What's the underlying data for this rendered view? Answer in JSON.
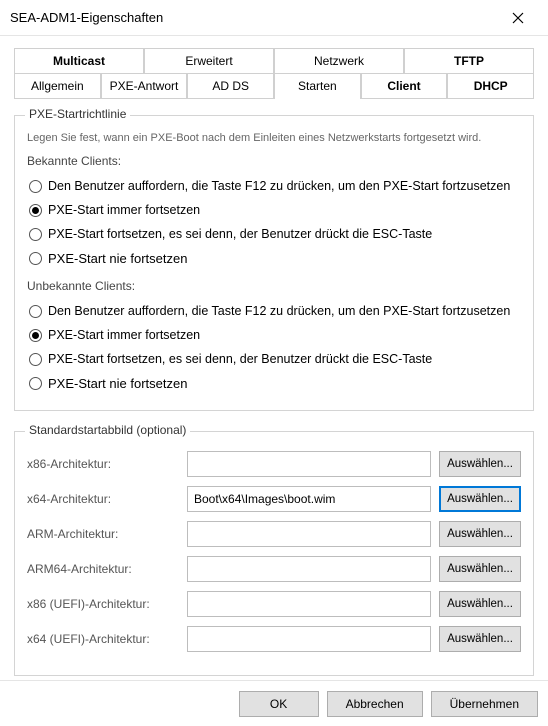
{
  "window": {
    "title": "SEA-ADM1-Eigenschaften"
  },
  "tabs_row1": [
    {
      "label": "Multicast",
      "bold": true
    },
    {
      "label": "Erweitert"
    },
    {
      "label": "Netzwerk"
    },
    {
      "label": "TFTP",
      "bold": true
    }
  ],
  "tabs_row2": [
    {
      "label": "Allgemein"
    },
    {
      "label": "PXE-Antwort"
    },
    {
      "label": "AD DS"
    },
    {
      "label": "Starten",
      "active": true
    },
    {
      "label": "Client",
      "bold": true
    },
    {
      "label": "DHCP",
      "bold": true
    }
  ],
  "policy": {
    "title": "PXE-Startrichtlinie",
    "desc": "Legen Sie fest, wann ein PXE-Boot nach dem Einleiten eines Netzwerkstarts fortgesetzt wird.",
    "known_header": "Bekannte Clients:",
    "unknown_header": "Unbekannte Clients:",
    "opts": [
      "Den Benutzer auffordern, die Taste F12 zu drücken, um den PXE-Start fortzusetzen",
      "PXE-Start immer fortsetzen",
      "PXE-Start fortsetzen, es sei denn, der Benutzer drückt die ESC-Taste",
      "PXE-Start nie fortsetzen"
    ]
  },
  "bootimg": {
    "title": "Standardstartabbild (optional)",
    "select_label": "Auswählen...",
    "rows": [
      {
        "label": "x86-Architektur:",
        "value": ""
      },
      {
        "label": "x64-Architektur:",
        "value": "Boot\\x64\\Images\\boot.wim",
        "focused": true
      },
      {
        "label": "ARM-Architektur:",
        "value": ""
      },
      {
        "label": "ARM64-Architektur:",
        "value": ""
      },
      {
        "label": "x86 (UEFI)-Architektur:",
        "value": ""
      },
      {
        "label": "x64 (UEFI)-Architektur:",
        "value": ""
      }
    ]
  },
  "footer": {
    "ok": "OK",
    "cancel": "Abbrechen",
    "apply": "Übernehmen"
  }
}
